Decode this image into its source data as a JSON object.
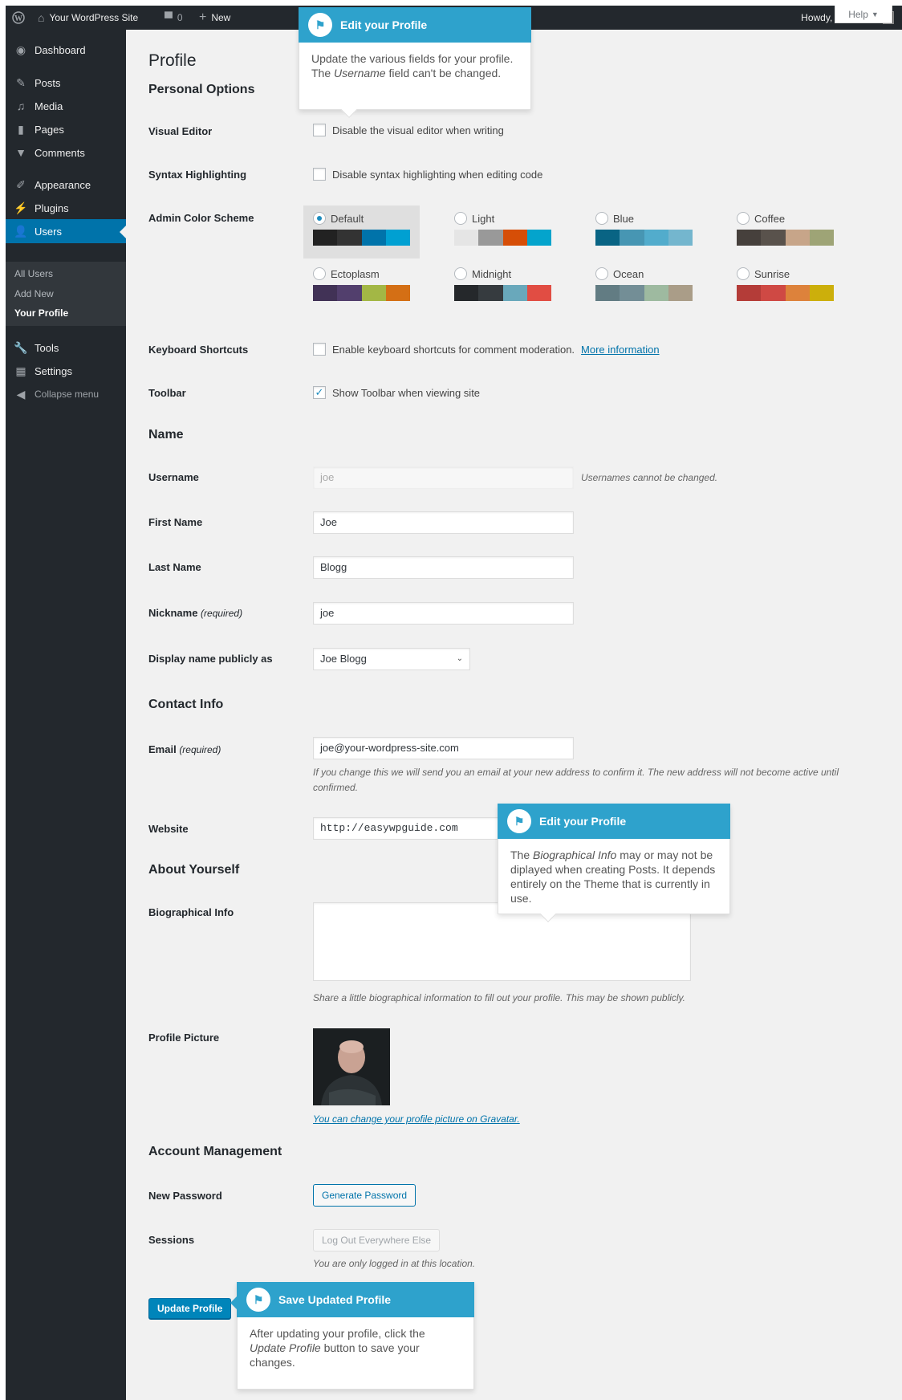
{
  "admin_bar": {
    "site_name": "Your WordPress Site",
    "comments_count": "0",
    "new_label": "New",
    "howdy": "Howdy, Joe Blogg"
  },
  "sidebar": {
    "items": [
      {
        "label": "Dashboard",
        "icon": "dashboard-icon"
      },
      {
        "label": "Posts",
        "icon": "pin-icon"
      },
      {
        "label": "Media",
        "icon": "media-icon"
      },
      {
        "label": "Pages",
        "icon": "pages-icon"
      },
      {
        "label": "Comments",
        "icon": "comment-icon"
      },
      {
        "label": "Appearance",
        "icon": "brush-icon"
      },
      {
        "label": "Plugins",
        "icon": "plug-icon"
      },
      {
        "label": "Users",
        "icon": "user-icon"
      },
      {
        "label": "Tools",
        "icon": "wrench-icon"
      },
      {
        "label": "Settings",
        "icon": "settings-icon"
      },
      {
        "label": "Collapse menu",
        "icon": "collapse-icon"
      }
    ],
    "submenu": [
      "All Users",
      "Add New",
      "Your Profile"
    ]
  },
  "help_tab": "Help",
  "page": {
    "title": "Profile",
    "personal_options": "Personal Options",
    "visual_editor_label": "Visual Editor",
    "visual_editor_text": "Disable the visual editor when writing",
    "syntax_label": "Syntax Highlighting",
    "syntax_text": "Disable syntax highlighting when editing code",
    "color_scheme_label": "Admin Color Scheme",
    "color_schemes": [
      {
        "name": "Default",
        "colors": [
          "#222222",
          "#333333",
          "#0073aa",
          "#00a0d2"
        ],
        "selected": true
      },
      {
        "name": "Light",
        "colors": [
          "#e5e5e5",
          "#999999",
          "#d64e07",
          "#04a4cc"
        ],
        "selected": false
      },
      {
        "name": "Blue",
        "colors": [
          "#096484",
          "#4796b3",
          "#52accc",
          "#74b6ce"
        ],
        "selected": false
      },
      {
        "name": "Coffee",
        "colors": [
          "#46403c",
          "#59524c",
          "#c7a589",
          "#9ea476"
        ],
        "selected": false
      },
      {
        "name": "Ectoplasm",
        "colors": [
          "#413256",
          "#523f6d",
          "#a3b745",
          "#d46f15"
        ],
        "selected": false
      },
      {
        "name": "Midnight",
        "colors": [
          "#25282b",
          "#363b3f",
          "#69a8bb",
          "#e14d43"
        ],
        "selected": false
      },
      {
        "name": "Ocean",
        "colors": [
          "#627c83",
          "#738e96",
          "#9ebaa0",
          "#aa9d88"
        ],
        "selected": false
      },
      {
        "name": "Sunrise",
        "colors": [
          "#b43c38",
          "#cf4944",
          "#dd823b",
          "#ccaf0b"
        ],
        "selected": false
      }
    ],
    "keyboard_label": "Keyboard Shortcuts",
    "keyboard_text": "Enable keyboard shortcuts for comment moderation.",
    "keyboard_link": "More information",
    "toolbar_label": "Toolbar",
    "toolbar_text": "Show Toolbar when viewing site",
    "name_heading": "Name",
    "username_label": "Username",
    "username_value": "joe",
    "username_note": "Usernames cannot be changed.",
    "first_name_label": "First Name",
    "first_name_value": "Joe",
    "last_name_label": "Last Name",
    "last_name_value": "Blogg",
    "nickname_label": "Nickname",
    "nickname_required": "(required)",
    "nickname_value": "joe",
    "display_name_label": "Display name publicly as",
    "display_name_value": "Joe Blogg",
    "contact_heading": "Contact Info",
    "email_label": "Email",
    "email_required": "(required)",
    "email_value": "joe@your-wordpress-site.com",
    "email_note": "If you change this we will send you an email at your new address to confirm it. The new address will not become active until confirmed.",
    "website_label": "Website",
    "website_value": "http://easywpguide.com",
    "about_heading": "About Yourself",
    "bio_label": "Biographical Info",
    "bio_note": "Share a little biographical information to fill out your profile. This may be shown publicly.",
    "picture_label": "Profile Picture",
    "picture_link": "You can change your profile picture on Gravatar.",
    "account_heading": "Account Management",
    "password_label": "New Password",
    "password_button": "Generate Password",
    "sessions_label": "Sessions",
    "sessions_button": "Log Out Everywhere Else",
    "sessions_note": "You are only logged in at this location.",
    "update_button": "Update Profile"
  },
  "pointers": {
    "profile": {
      "title": "Edit your Profile",
      "body_pre": "Update the various fields for your profile. The ",
      "body_em": "Username",
      "body_post": " field can't be changed."
    },
    "bio": {
      "title": "Edit your Profile",
      "body_pre": "The ",
      "body_em": "Biographical Info",
      "body_post": " may or may not be diplayed when creating Posts. It depends entirely on the Theme that is currently in use."
    },
    "save": {
      "title": "Save Updated Profile",
      "body_pre": "After updating your profile, click the ",
      "body_em": "Update Profile",
      "body_post": " button to save your changes."
    }
  }
}
